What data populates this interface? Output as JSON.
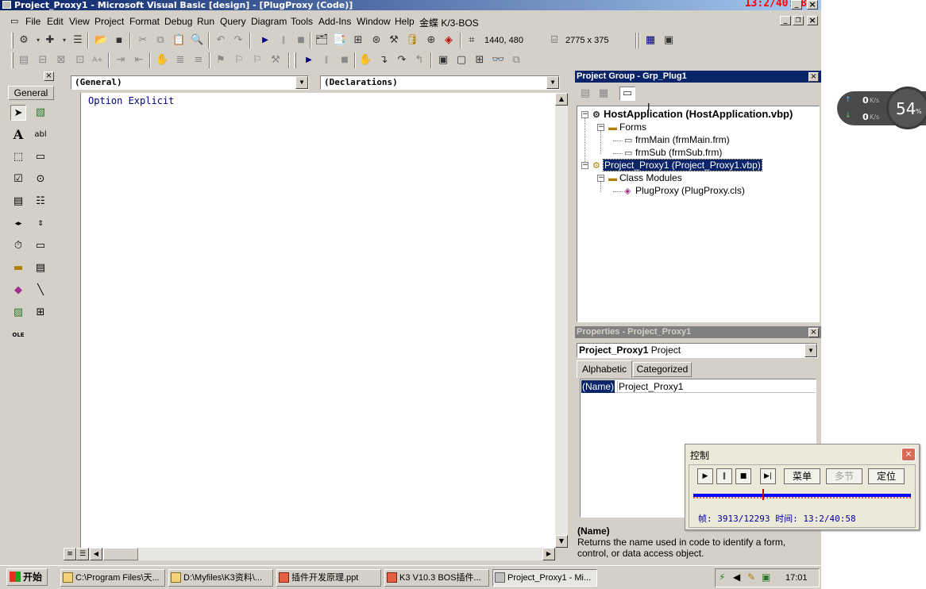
{
  "window": {
    "title": "Project_Proxy1 - Microsoft Visual Basic [design] - [PlugProxy (Code)]",
    "overlay_clock": "13:2/40:58"
  },
  "menu": [
    "File",
    "Edit",
    "View",
    "Project",
    "Format",
    "Debug",
    "Run",
    "Query",
    "Diagram",
    "Tools",
    "Add-Ins",
    "Window",
    "Help",
    "金蝶 K/3-BOS"
  ],
  "toolbar": {
    "position": "1440, 480",
    "size": "2775 x 375"
  },
  "toolbox": {
    "header": "General"
  },
  "code": {
    "object_combo": "(General)",
    "proc_combo": "(Declarations)",
    "lines": [
      "Option Explicit"
    ]
  },
  "project": {
    "title": "Project Group - Grp_Plug1",
    "nodes": [
      {
        "label": "HostApplication (HostApplication.vbp)",
        "icon": "project-icon"
      },
      {
        "label": "Forms",
        "icon": "folder-icon"
      },
      {
        "label": "frmMain (frmMain.frm)",
        "icon": "form-icon"
      },
      {
        "label": "frmSub (frmSub.frm)",
        "icon": "form-icon"
      },
      {
        "label": "Project_Proxy1 (Project_Proxy1.vbp)",
        "icon": "project-icon",
        "selected": true
      },
      {
        "label": "Class Modules",
        "icon": "folder-icon"
      },
      {
        "label": "PlugProxy (PlugProxy.cls)",
        "icon": "class-icon"
      }
    ]
  },
  "properties": {
    "title": "Properties - Project_Proxy1",
    "object": "Project_Proxy1",
    "object_type": "Project",
    "tabs": [
      "Alphabetic",
      "Categorized"
    ],
    "rows": [
      {
        "name": "(Name)",
        "value": "Project_Proxy1"
      }
    ],
    "desc_title": "(Name)",
    "desc_text": "Returns the name used in code to identify a form, control, or data access object."
  },
  "control": {
    "title": "控制",
    "buttons": [
      "菜单",
      "多节",
      "定位"
    ],
    "status": "帧: 3913/12293 时间: 13:2/40:58",
    "progress_fraction": 0.3183
  },
  "net": {
    "up": "0",
    "down": "0",
    "unit": "K/s",
    "percent": "54",
    "percent_sign": "%"
  },
  "taskbar": {
    "start": "开始",
    "tasks": [
      "C:\\Program Files\\天...",
      "D:\\Myfiles\\K3资料\\...",
      "插件开发原理.ppt",
      "K3 V10.3 BOS插件...",
      "Project_Proxy1 - Mi..."
    ],
    "clock": "17:01"
  },
  "colors": {
    "title_active": "#0a246a",
    "title_inactive": "#808080",
    "code_text": "#000080",
    "progress": "#0000ff"
  }
}
